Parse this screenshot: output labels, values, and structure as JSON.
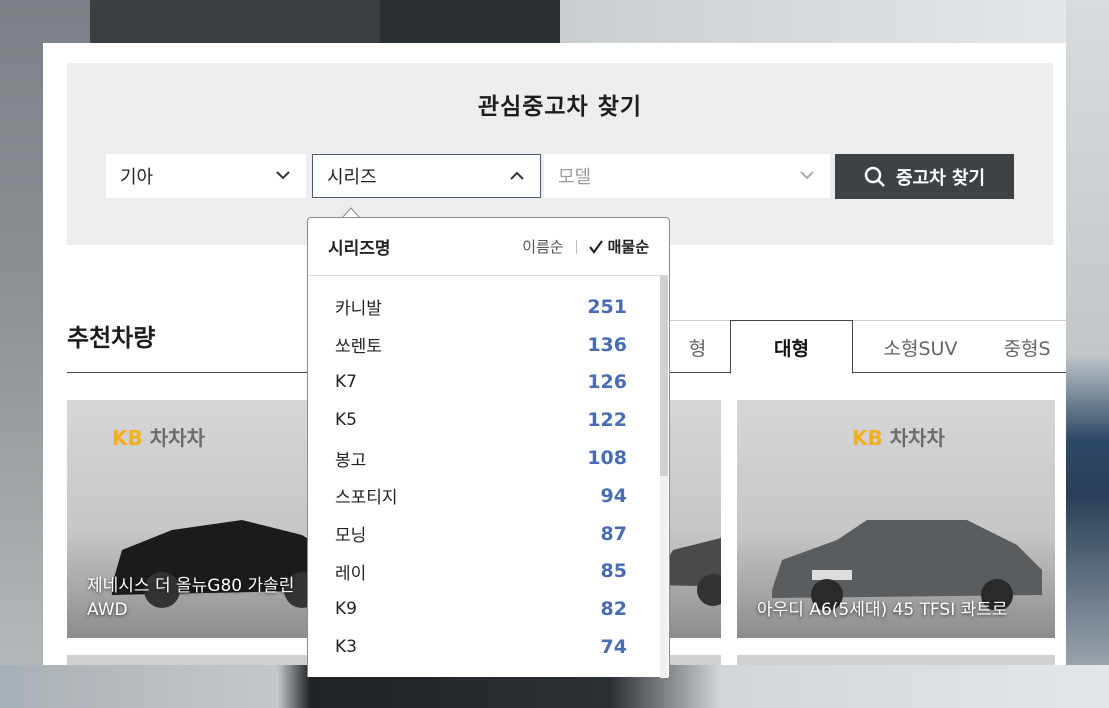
{
  "search": {
    "title": "관심중고차 찾기",
    "brand_value": "기아",
    "series_value": "시리즈",
    "model_placeholder": "모델",
    "button_label": "중고차 찾기"
  },
  "dropdown": {
    "header_label": "시리즈명",
    "sort_name": "이름순",
    "sort_count": "매물순",
    "items": [
      {
        "name": "카니발",
        "count": "251"
      },
      {
        "name": "쏘렌토",
        "count": "136"
      },
      {
        "name": "K7",
        "count": "126"
      },
      {
        "name": "K5",
        "count": "122"
      },
      {
        "name": "봉고",
        "count": "108"
      },
      {
        "name": "스포티지",
        "count": "94"
      },
      {
        "name": "모닝",
        "count": "87"
      },
      {
        "name": "레이",
        "count": "85"
      },
      {
        "name": "K9",
        "count": "82"
      },
      {
        "name": "K3",
        "count": "74"
      }
    ]
  },
  "recommended": {
    "title": "추천차량",
    "tabs": [
      "형",
      "대형",
      "소형SUV",
      "중형S"
    ],
    "active_tab": "대형"
  },
  "cards": [
    {
      "logo_kb": "KB",
      "logo_name": "차차차",
      "caption_line1": "제네시스 더 올뉴G80 가솔린",
      "caption_line2": "AWD"
    },
    {
      "logo_kb": "KB",
      "logo_name": "차차차",
      "caption_line1": "아우디 A6(5세대) 45 TFSI 콰트로",
      "caption_line2": ""
    }
  ],
  "colors": {
    "accent_blue": "#4a6cb3",
    "button_dark": "#3d4246",
    "kb_yellow": "#f2b01e"
  }
}
